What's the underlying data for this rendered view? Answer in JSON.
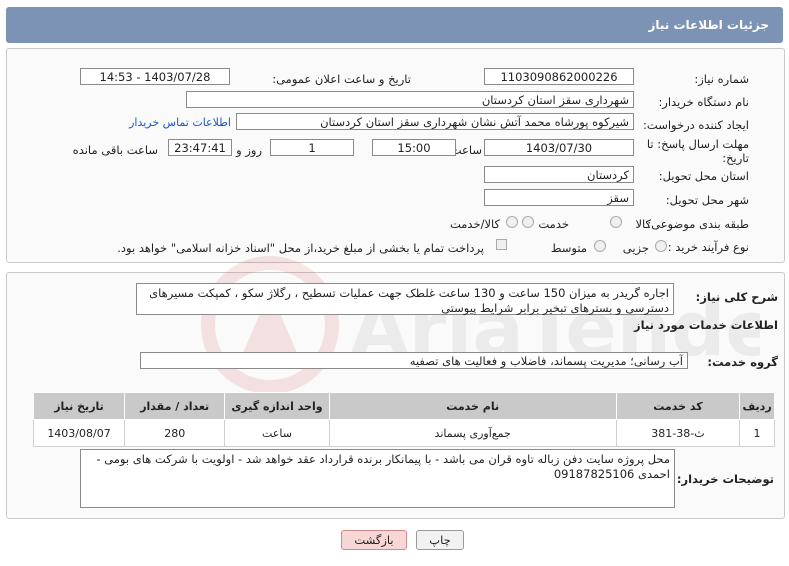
{
  "header": {
    "title": "جزئیات اطلاعات نیاز"
  },
  "need_number": {
    "label": "شماره نیاز:",
    "value": "1103090862000226"
  },
  "announce_datetime": {
    "label": "تاریخ و ساعت اعلان عمومی:",
    "value": "1403/07/28 - 14:53"
  },
  "buyer_org": {
    "label": "نام دستگاه خریدار:",
    "value": "شهرداری سقز استان کردستان"
  },
  "requester": {
    "label": "ایجاد کننده درخواست:",
    "value": "شیرکوه پورشاه محمد آتش نشان شهرداری سقز استان کردستان",
    "contact_link": "اطلاعات تماس خریدار"
  },
  "deadline": {
    "label_line1": "مهلت ارسال پاسخ: تا",
    "label_line2": "تاریخ:",
    "date": "1403/07/30",
    "time_label": "ساعت",
    "time": "15:00",
    "days": "1",
    "days_label": "روز و",
    "remaining": "23:47:41",
    "remaining_label": "ساعت باقی مانده"
  },
  "delivery_province": {
    "label": "استان محل تحویل:",
    "value": "کردستان"
  },
  "delivery_city": {
    "label": "شهر محل تحویل:",
    "value": "سقز"
  },
  "category": {
    "label": "طبقه بندی موضوعی:",
    "options": [
      "کالا",
      "خدمت",
      "کالا/خدمت"
    ]
  },
  "process": {
    "label": "نوع فرآیند خرید :",
    "options": [
      "جزیی",
      "متوسط"
    ],
    "note": "پرداخت تمام یا بخشی از مبلغ خرید،از محل \"اسناد خزانه اسلامی\" خواهد بود."
  },
  "summary": {
    "label": "شرح کلی نیاز:",
    "text": "اجاره گریدر به میزان 150 ساعت و 130 ساعت غلطک جهت عملیات تسطیح ، رگلاژ سکو ، کمپکت مسیرهای دسترسی و بسترهای تبخیر برابر شرایط پیوستی"
  },
  "services_section": {
    "title": "اطلاعات خدمات مورد نیاز"
  },
  "service_group": {
    "label": "گروه خدمت:",
    "value": "آب رسانی؛ مدیریت پسماند، فاضلاب و فعالیت های تصفیه"
  },
  "table": {
    "headers": [
      "ردیف",
      "کد خدمت",
      "نام خدمت",
      "واحد اندازه گیری",
      "تعداد / مقدار",
      "تاریخ نیاز"
    ],
    "rows": [
      [
        "1",
        "ث-38-381",
        "جمع‌آوری پسماند",
        "ساعت",
        "280",
        "1403/08/07"
      ]
    ]
  },
  "buyer_notes": {
    "label": "توضیحات خریدار:",
    "text": "محل پروژه سایت دفن زباله تاوه قران می باشد - با پیمانکار برنده قرارداد عقد خواهد شد - اولویت با شرکت های بومی - احمدی 09187825106"
  },
  "buttons": {
    "print": "چاپ",
    "back": "بازگشت"
  },
  "watermark": {
    "text": "AriaTender.neT"
  }
}
